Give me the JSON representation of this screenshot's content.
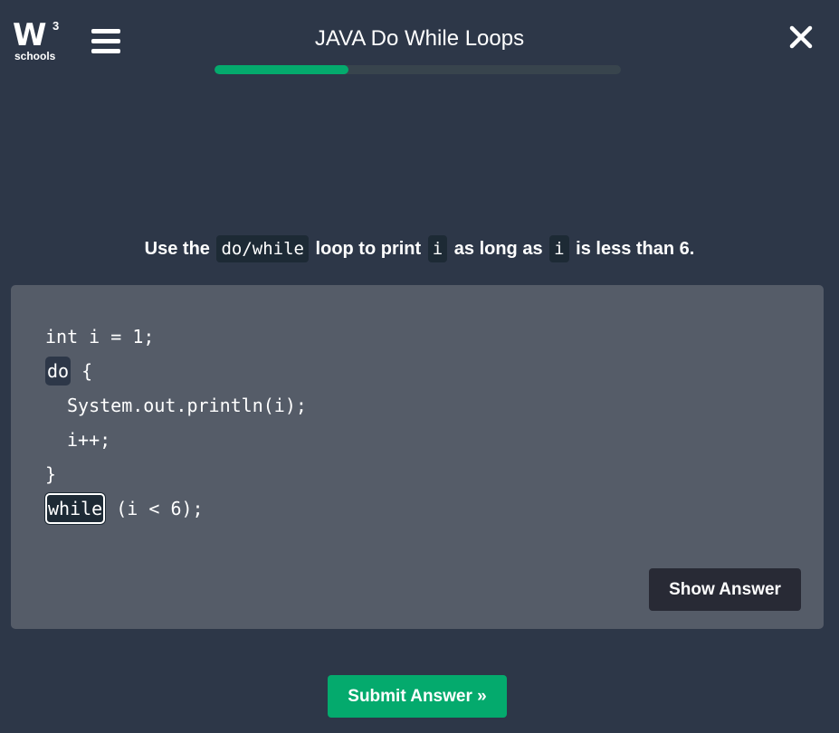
{
  "header": {
    "logo": {
      "mark": "W",
      "superscript": "3",
      "wordmark": "schools"
    },
    "menu_icon": "hamburger-icon",
    "title": "JAVA Do While Loops",
    "close_icon": "close-icon",
    "progress": {
      "value": 0.33,
      "color": "#04aa6d",
      "track_color": "#38444d"
    }
  },
  "exercise": {
    "instruction": {
      "part1": "Use the",
      "code1": "do/while",
      "part2": "loop to print",
      "code2": "i",
      "part3": "as long as",
      "code3": "i",
      "part4": "is less than 6."
    },
    "code": {
      "line1": "int i = 1;",
      "line2_blank": "do",
      "line2_rest": " {",
      "line3": "System.out.println(i);",
      "line4": "i++;",
      "line5": "}",
      "line6_blank": "while",
      "line6_rest": " (i < 6);"
    },
    "show_answer_label": "Show Answer",
    "submit_label": "Submit Answer »"
  },
  "colors": {
    "background": "#2d3748",
    "panel": "#555c68",
    "accent": "#04aa6d",
    "dark_button": "#282a35"
  }
}
